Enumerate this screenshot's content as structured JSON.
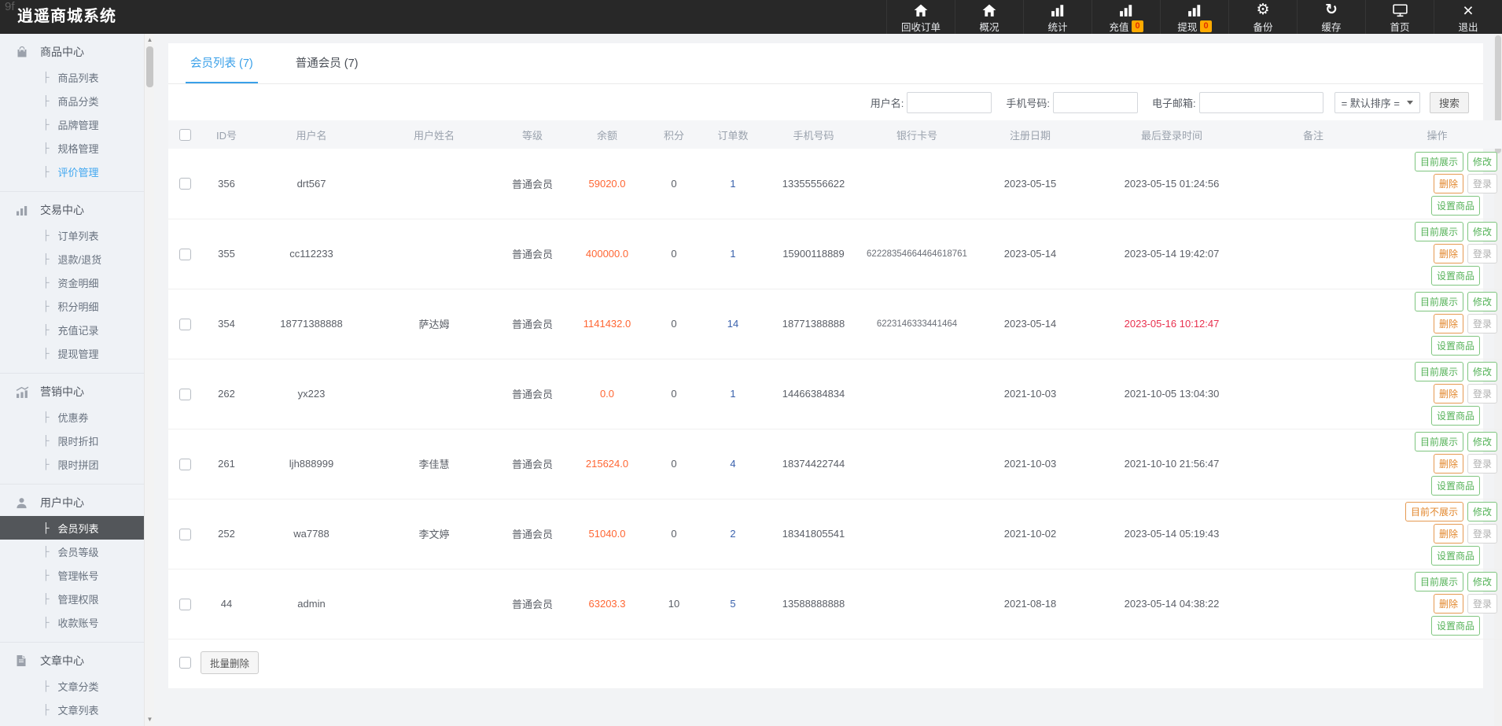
{
  "watermark": "9f",
  "header": {
    "title": "逍遥商城系统",
    "nav": [
      {
        "id": "recycle-orders",
        "icon": "home",
        "label": "回收订单"
      },
      {
        "id": "overview",
        "icon": "home",
        "label": "概况"
      },
      {
        "id": "stats",
        "icon": "bar-chart",
        "label": "统计"
      },
      {
        "id": "recharge",
        "icon": "bar-chart",
        "label": "充值",
        "badge": "0"
      },
      {
        "id": "withdraw",
        "icon": "bar-chart",
        "label": "提现",
        "badge": "0"
      },
      {
        "id": "backup",
        "icon": "gear",
        "label": "备份"
      },
      {
        "id": "cache",
        "icon": "refresh",
        "label": "缓存"
      },
      {
        "id": "homepage",
        "icon": "monitor",
        "label": "首页"
      },
      {
        "id": "logout",
        "icon": "close",
        "label": "退出"
      }
    ]
  },
  "sidebar": {
    "sections": [
      {
        "id": "product-center",
        "icon": "bag",
        "title": "商品中心",
        "items": [
          {
            "id": "product-list",
            "label": "商品列表"
          },
          {
            "id": "product-category",
            "label": "商品分类"
          },
          {
            "id": "brand-manage",
            "label": "品牌管理"
          },
          {
            "id": "spec-manage",
            "label": "规格管理"
          },
          {
            "id": "review-manage",
            "label": "评价管理",
            "highlight": true
          }
        ]
      },
      {
        "id": "trade-center",
        "icon": "chart",
        "title": "交易中心",
        "items": [
          {
            "id": "order-list",
            "label": "订单列表"
          },
          {
            "id": "refund-return",
            "label": "退款/退货"
          },
          {
            "id": "funds-detail",
            "label": "资金明细"
          },
          {
            "id": "points-detail",
            "label": "积分明细"
          },
          {
            "id": "recharge-records",
            "label": "充值记录"
          },
          {
            "id": "withdraw-manage",
            "label": "提现管理"
          }
        ]
      },
      {
        "id": "marketing-center",
        "icon": "trend",
        "title": "营销中心",
        "items": [
          {
            "id": "coupon",
            "label": "优惠券"
          },
          {
            "id": "time-discount",
            "label": "限时折扣"
          },
          {
            "id": "group-buy",
            "label": "限时拼团"
          }
        ]
      },
      {
        "id": "user-center",
        "icon": "user",
        "title": "用户中心",
        "items": [
          {
            "id": "member-list",
            "label": "会员列表",
            "active": true
          },
          {
            "id": "member-level",
            "label": "会员等级"
          },
          {
            "id": "admin-accounts",
            "label": "管理帐号"
          },
          {
            "id": "admin-permissions",
            "label": "管理权限"
          },
          {
            "id": "payee-accounts",
            "label": "收款账号"
          }
        ]
      },
      {
        "id": "article-center",
        "icon": "doc",
        "title": "文章中心",
        "items": [
          {
            "id": "article-category",
            "label": "文章分类"
          },
          {
            "id": "article-list",
            "label": "文章列表"
          }
        ]
      }
    ]
  },
  "tabs": [
    {
      "id": "member-list",
      "label": "会员列表 (7)",
      "active": true
    },
    {
      "id": "normal-member",
      "label": "普通会员 (7)",
      "active": false
    }
  ],
  "filters": {
    "username_label": "用户名:",
    "phone_label": "手机号码:",
    "email_label": "电子邮箱:",
    "sort_value": "= 默认排序 =",
    "search_label": "搜索"
  },
  "table": {
    "headers": [
      "ID号",
      "用户名",
      "用户姓名",
      "等级",
      "余额",
      "积分",
      "订单数",
      "手机号码",
      "银行卡号",
      "注册日期",
      "最后登录时间",
      "备注",
      "操作"
    ],
    "actions": {
      "edit": "修改",
      "del": "删除",
      "login": "登录",
      "set_goods": "设置商品"
    },
    "rows": [
      {
        "id": "356",
        "username": "drt567",
        "realname": "",
        "level": "普通会员",
        "balance": "59020.0",
        "points": "0",
        "orders": "1",
        "phone": "13355556622",
        "bank": "",
        "reg_date": "2023-05-15",
        "last_login": "2023-05-15 01:24:56",
        "login_red": false,
        "remark": "",
        "show_label": "目前展示",
        "show_state": "green"
      },
      {
        "id": "355",
        "username": "cc112233",
        "realname": "",
        "level": "普通会员",
        "balance": "400000.0",
        "points": "0",
        "orders": "1",
        "phone": "15900118889",
        "bank": "62228354664464618761",
        "reg_date": "2023-05-14",
        "last_login": "2023-05-14 19:42:07",
        "login_red": false,
        "remark": "",
        "show_label": "目前展示",
        "show_state": "green"
      },
      {
        "id": "354",
        "username": "18771388888",
        "realname": "萨达姆",
        "level": "普通会员",
        "balance": "1141432.0",
        "points": "0",
        "orders": "14",
        "phone": "18771388888",
        "bank": "6223146333441464",
        "reg_date": "2023-05-14",
        "last_login": "2023-05-16 10:12:47",
        "login_red": true,
        "remark": "",
        "show_label": "目前展示",
        "show_state": "green"
      },
      {
        "id": "262",
        "username": "yx223",
        "realname": "",
        "level": "普通会员",
        "balance": "0.0",
        "points": "0",
        "orders": "1",
        "phone": "14466384834",
        "bank": "",
        "reg_date": "2021-10-03",
        "last_login": "2021-10-05 13:04:30",
        "login_red": false,
        "remark": "",
        "show_label": "目前展示",
        "show_state": "green"
      },
      {
        "id": "261",
        "username": "ljh888999",
        "realname": "李佳慧",
        "level": "普通会员",
        "balance": "215624.0",
        "points": "0",
        "orders": "4",
        "phone": "18374422744",
        "bank": "",
        "reg_date": "2021-10-03",
        "last_login": "2021-10-10 21:56:47",
        "login_red": false,
        "remark": "",
        "show_label": "目前展示",
        "show_state": "green"
      },
      {
        "id": "252",
        "username": "wa7788",
        "realname": "李文婷",
        "level": "普通会员",
        "balance": "51040.0",
        "points": "0",
        "orders": "2",
        "phone": "18341805541",
        "bank": "",
        "reg_date": "2021-10-02",
        "last_login": "2023-05-14 05:19:43",
        "login_red": false,
        "remark": "",
        "show_label": "目前不展示",
        "show_state": "orange"
      },
      {
        "id": "44",
        "username": "admin",
        "realname": "",
        "level": "普通会员",
        "balance": "63203.3",
        "points": "10",
        "orders": "5",
        "phone": "13588888888",
        "bank": "",
        "reg_date": "2021-08-18",
        "last_login": "2023-05-14 04:38:22",
        "login_red": false,
        "remark": "",
        "show_label": "目前展示",
        "show_state": "green"
      }
    ]
  },
  "footer": {
    "bulk_delete_label": "批量删除"
  },
  "colors": {
    "topbar_bg": "#282828",
    "accent_blue": "#3aa0e9",
    "money_orange": "#ff6633",
    "link_blue": "#3b62ad",
    "alert_red": "#e8304e",
    "button_green": "#54b257",
    "button_orange": "#e2862b",
    "badge_bg": "#ffaa00",
    "sidebar_bg": "#eff2f6",
    "sidebar_active_bg": "#53565a"
  }
}
